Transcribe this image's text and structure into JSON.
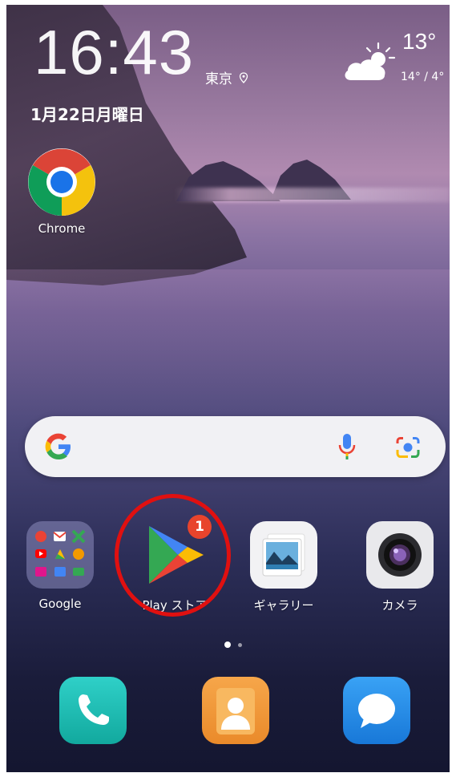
{
  "status": {
    "time": "16:43",
    "city": "東京",
    "date": "1月22日月曜日",
    "temperature": "13°",
    "temp_range": "14° / 4°"
  },
  "home_apps": [
    {
      "label": "Chrome",
      "icon": "chrome-icon"
    }
  ],
  "search": {
    "icon": "google-g-icon",
    "mic_icon": "mic-icon",
    "lens_icon": "lens-icon"
  },
  "app_row": [
    {
      "label": "Google",
      "icon": "google-folder-icon"
    },
    {
      "label": "Play ストア",
      "icon": "play-store-icon",
      "badge": "1"
    },
    {
      "label": "ギャラリー",
      "icon": "gallery-icon"
    },
    {
      "label": "カメラ",
      "icon": "camera-icon"
    }
  ],
  "dock": [
    {
      "icon": "phone-icon"
    },
    {
      "icon": "contacts-icon"
    },
    {
      "icon": "messages-icon"
    }
  ],
  "colors": {
    "highlight_circle": "#e01010",
    "badge": "#e8442c"
  }
}
